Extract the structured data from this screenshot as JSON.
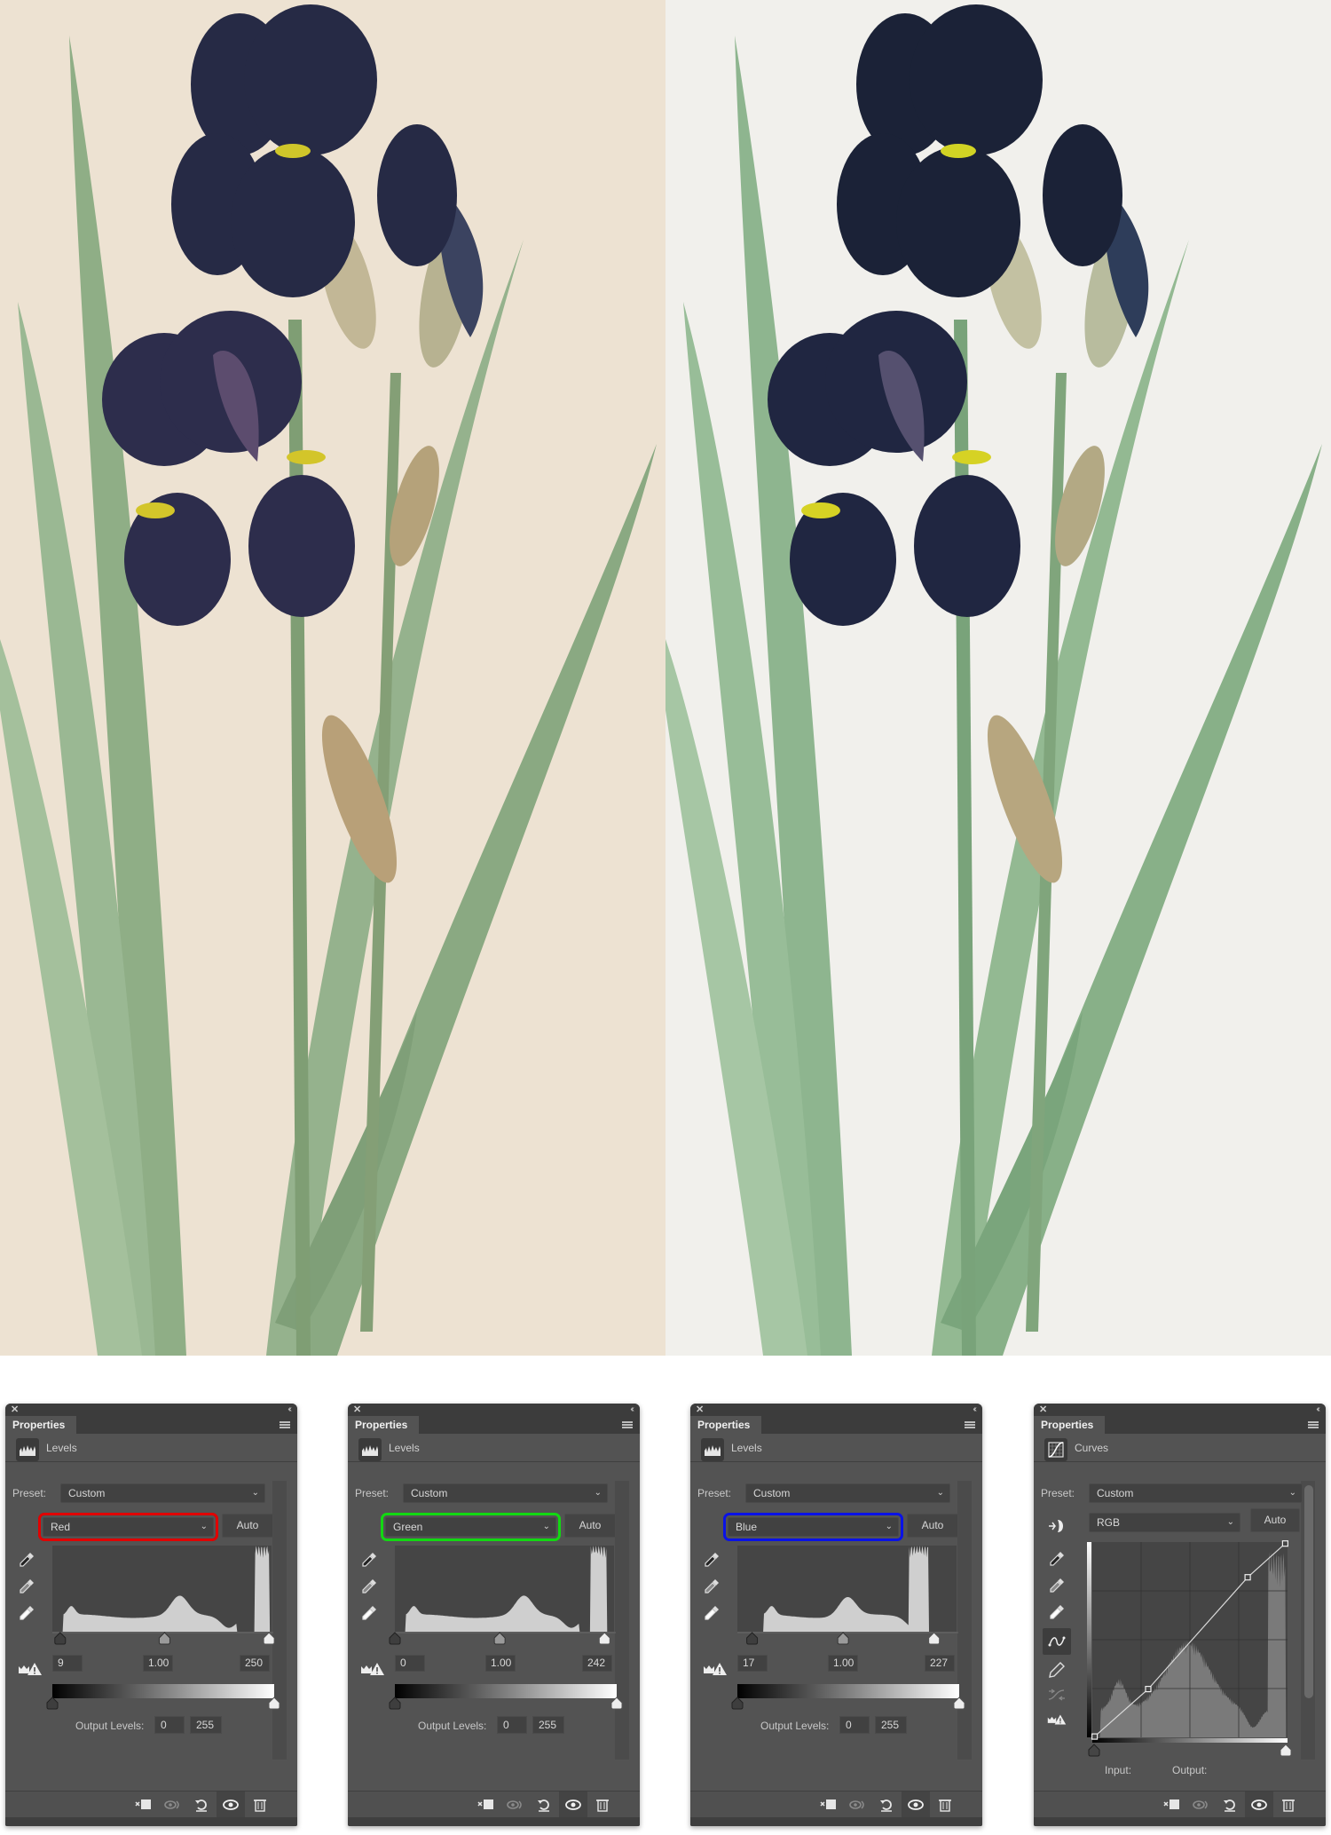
{
  "images": {
    "before": {
      "label": "original-iris-illustration",
      "paper_color": "#ede2d2"
    },
    "after": {
      "label": "corrected-iris-illustration",
      "paper_color": "#f1f0ec"
    }
  },
  "colors": {
    "panel_bg": "#535353",
    "red_highlight": "#e00000",
    "green_highlight": "#12d812",
    "blue_highlight": "#0a12e6"
  },
  "panels": [
    {
      "tab": "Properties",
      "adjustment": "Levels",
      "preset_label": "Preset:",
      "preset": "Custom",
      "channel": "Red",
      "auto": "Auto",
      "input_black": "9",
      "input_gamma": "1.00",
      "input_white": "250",
      "output_label": "Output Levels:",
      "output_black": "0",
      "output_white": "255",
      "levels": {
        "black": 9,
        "gamma": 1.0,
        "white": 250,
        "out_black": 0,
        "out_white": 255
      }
    },
    {
      "tab": "Properties",
      "adjustment": "Levels",
      "preset_label": "Preset:",
      "preset": "Custom",
      "channel": "Green",
      "auto": "Auto",
      "input_black": "0",
      "input_gamma": "1.00",
      "input_white": "242",
      "output_label": "Output Levels:",
      "output_black": "0",
      "output_white": "255",
      "levels": {
        "black": 0,
        "gamma": 1.0,
        "white": 242,
        "out_black": 0,
        "out_white": 255
      }
    },
    {
      "tab": "Properties",
      "adjustment": "Levels",
      "preset_label": "Preset:",
      "preset": "Custom",
      "channel": "Blue",
      "auto": "Auto",
      "input_black": "17",
      "input_gamma": "1.00",
      "input_white": "227",
      "output_label": "Output Levels:",
      "output_black": "0",
      "output_white": "255",
      "levels": {
        "black": 17,
        "gamma": 1.0,
        "white": 227,
        "out_black": 0,
        "out_white": 255
      }
    },
    {
      "tab": "Properties",
      "adjustment": "Curves",
      "preset_label": "Preset:",
      "preset": "Custom",
      "channel": "RGB",
      "auto": "Auto",
      "input_label": "Input:",
      "output_label": "Output:",
      "curve_points": [
        [
          3,
          1
        ],
        [
          73,
          63
        ],
        [
          203,
          209
        ],
        [
          252,
          253
        ]
      ]
    }
  ],
  "footer_buttons": [
    "clip-to-layer",
    "view-previous-state",
    "reset-to-defaults",
    "toggle-visibility",
    "delete-layer"
  ]
}
